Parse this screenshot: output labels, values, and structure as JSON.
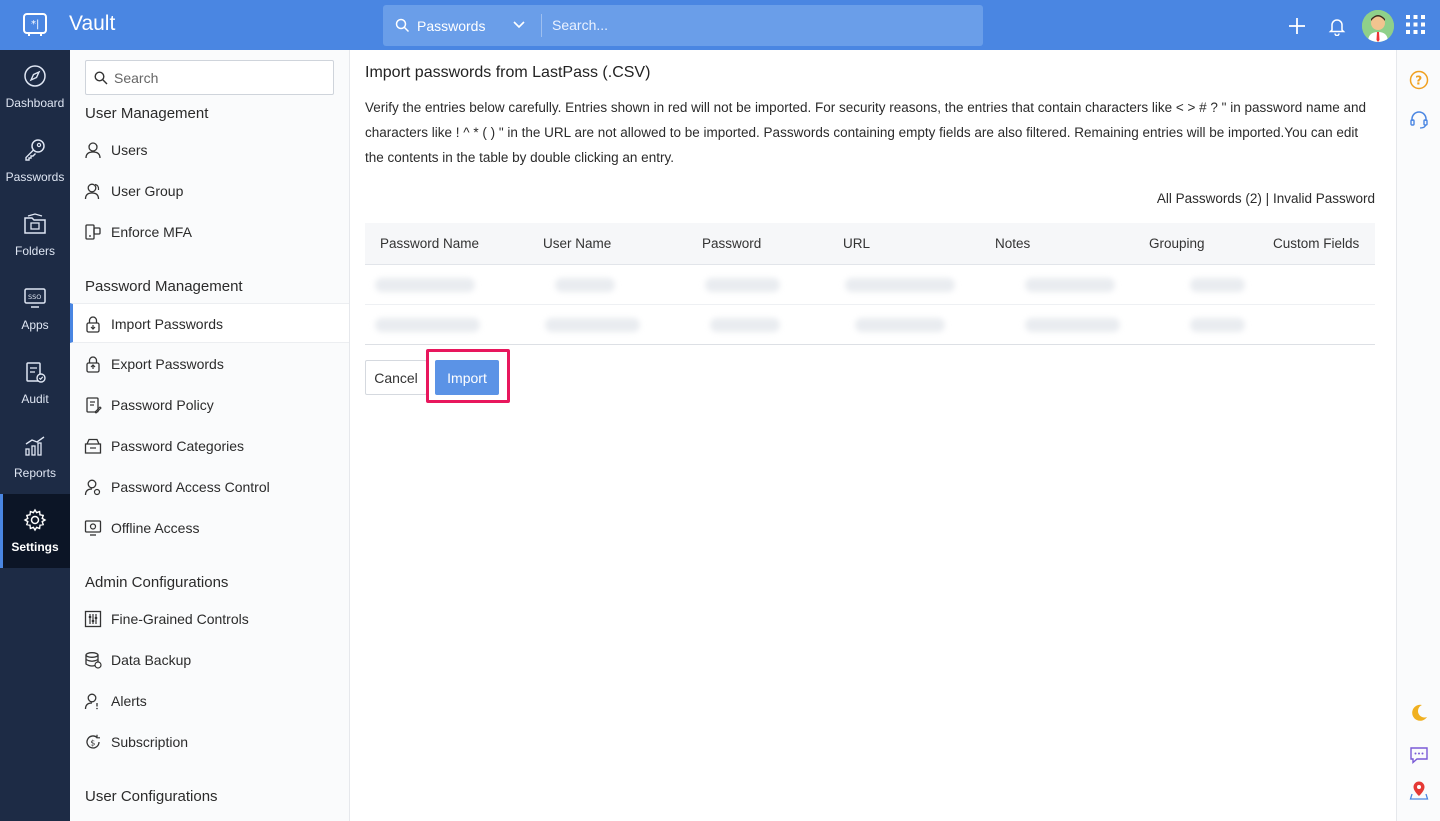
{
  "app": {
    "title": "Vault"
  },
  "topbar": {
    "search_scope": "Passwords",
    "search_placeholder": "Search..."
  },
  "leftnav": {
    "items": [
      {
        "label": "Dashboard",
        "icon": "dashboard-icon"
      },
      {
        "label": "Passwords",
        "icon": "key-icon"
      },
      {
        "label": "Folders",
        "icon": "folder-icon"
      },
      {
        "label": "Apps",
        "icon": "sso-icon"
      },
      {
        "label": "Audit",
        "icon": "audit-icon"
      },
      {
        "label": "Reports",
        "icon": "reports-icon"
      },
      {
        "label": "Settings",
        "icon": "gear-icon",
        "active": true
      }
    ]
  },
  "sidebar": {
    "search_placeholder": "Search",
    "sections": [
      {
        "title": "User Management",
        "items": [
          "Users",
          "User Group",
          "Enforce MFA"
        ]
      },
      {
        "title": "Password Management",
        "items": [
          "Import Passwords",
          "Export Passwords",
          "Password Policy",
          "Password Categories",
          "Password Access Control",
          "Offline Access"
        ],
        "active": "Import Passwords"
      },
      {
        "title": "Admin Configurations",
        "items": [
          "Fine-Grained Controls",
          "Data Backup",
          "Alerts",
          "Subscription"
        ]
      },
      {
        "title": "User Configurations",
        "items": []
      }
    ]
  },
  "main": {
    "title": "Import passwords from LastPass (.CSV)",
    "description": "Verify the entries below carefully. Entries shown in red will not be imported. For security reasons, the entries that contain characters like < > # ? \" in password name and characters like ! ^ * ( ) \" in the URL are not allowed to be imported. Passwords containing empty fields are also filtered. Remaining entries will be imported.You can edit the contents in the table by double clicking an entry.",
    "filter_all": "All Passwords (2)",
    "filter_sep": "|",
    "filter_invalid": "Invalid Password",
    "table": {
      "columns": [
        "Password Name",
        "User Name",
        "Password",
        "URL",
        "Notes",
        "Grouping",
        "Custom Fields"
      ],
      "row_count": 2
    },
    "cancel_label": "Cancel",
    "import_label": "Import"
  },
  "colors": {
    "topbar": "#4a86e2",
    "leftnav": "#1d2b45",
    "highlight": "#e8175d",
    "import_button": "#5b93e6"
  }
}
